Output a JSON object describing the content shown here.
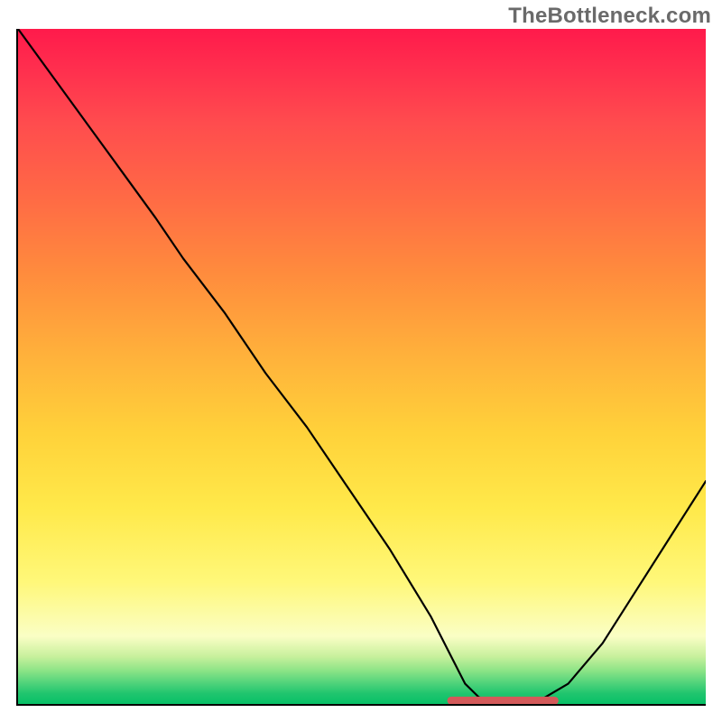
{
  "watermark": "TheBottleneck.com",
  "chart_data": {
    "type": "line",
    "title": "",
    "xlabel": "",
    "ylabel": "",
    "xlim": [
      0,
      100
    ],
    "ylim": [
      0,
      100
    ],
    "grid": false,
    "legend": false,
    "series": [
      {
        "name": "bottleneck-curve",
        "color": "#000000",
        "x": [
          0,
          5,
          10,
          15,
          20,
          24,
          30,
          36,
          42,
          48,
          54,
          60,
          63,
          65,
          67,
          70,
          75,
          80,
          85,
          90,
          95,
          100
        ],
        "values": [
          100,
          93,
          86,
          79,
          72,
          66,
          58,
          49,
          41,
          32,
          23,
          13,
          7,
          3,
          1,
          0,
          0,
          3,
          9,
          17,
          25,
          33
        ]
      }
    ],
    "optimal_range": {
      "name": "optimal-marker",
      "color": "#d35a5a",
      "x_start": 63,
      "x_end": 78,
      "y": 0.5
    },
    "background_gradient_stops": [
      {
        "pos": 0.0,
        "color": "#ff1a4b"
      },
      {
        "pos": 0.25,
        "color": "#ff6a45"
      },
      {
        "pos": 0.5,
        "color": "#ffb83b"
      },
      {
        "pos": 0.72,
        "color": "#ffe94a"
      },
      {
        "pos": 0.9,
        "color": "#fafec5"
      },
      {
        "pos": 1.0,
        "color": "#08c067"
      }
    ]
  }
}
